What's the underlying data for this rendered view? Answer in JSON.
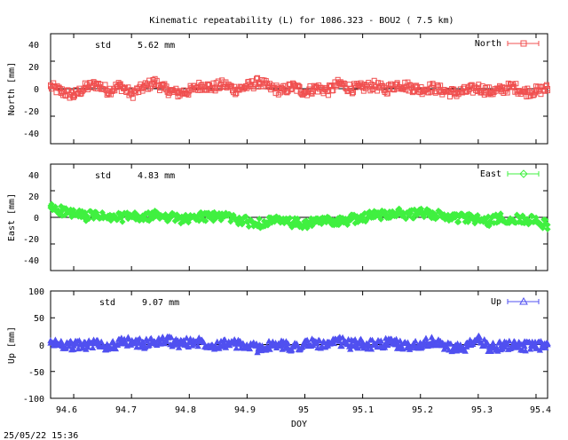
{
  "chart_data": {
    "type": "scatter",
    "title": "Kinematic repeatability (L) for 1086.323 - BOU2  (  7.5 km)",
    "xlabel": "DOY",
    "xlim": [
      94.56,
      95.42
    ],
    "x_ticks": [
      "94.6",
      "94.7",
      "94.8",
      "94.9",
      "95",
      "95.1",
      "95.2",
      "95.3",
      "95.4"
    ],
    "timestamp": "25/05/22 15:36",
    "panels": [
      {
        "ylabel": "North [mm]",
        "ylim": [
          -50,
          50
        ],
        "y_ticks": [
          "40",
          "20",
          "0",
          "-20",
          "-40"
        ],
        "std_label": "std",
        "std_value": "5.62 mm",
        "series": [
          {
            "name": "North",
            "color": "#f05050",
            "marker": "square",
            "x": [
              94.56,
              94.58,
              94.6,
              94.62,
              94.64,
              94.66,
              94.68,
              94.7,
              94.72,
              94.74,
              94.76,
              94.78,
              94.8,
              94.82,
              94.84,
              94.86,
              94.88,
              94.9,
              94.92,
              94.94,
              94.96,
              94.98,
              95.0,
              95.02,
              95.04,
              95.06,
              95.08,
              95.1,
              95.12,
              95.14,
              95.16,
              95.18,
              95.2,
              95.22,
              95.24,
              95.26,
              95.28,
              95.3,
              95.32,
              95.34,
              95.36,
              95.38,
              95.4,
              95.42
            ],
            "y": [
              2,
              -3,
              -6,
              1,
              4,
              -2,
              3,
              -5,
              1,
              6,
              -1,
              -4,
              -2,
              3,
              1,
              4,
              -1,
              2,
              6,
              1,
              -2,
              2,
              -3,
              1,
              -2,
              5,
              0,
              1,
              3,
              -1,
              4,
              2,
              -1,
              1,
              -2,
              -4,
              -2,
              1,
              -3,
              -1,
              2,
              -3,
              -2,
              0
            ]
          }
        ]
      },
      {
        "ylabel": "East [mm]",
        "ylim": [
          -50,
          50
        ],
        "y_ticks": [
          "40",
          "20",
          "0",
          "-20",
          "-40"
        ],
        "std_label": "std",
        "std_value": "4.83 mm",
        "series": [
          {
            "name": "East",
            "color": "#40f040",
            "marker": "diamond",
            "x": [
              94.56,
              94.58,
              94.6,
              94.62,
              94.64,
              94.66,
              94.68,
              94.7,
              94.72,
              94.74,
              94.76,
              94.78,
              94.8,
              94.82,
              94.84,
              94.86,
              94.88,
              94.9,
              94.92,
              94.94,
              94.96,
              94.98,
              95.0,
              95.02,
              95.04,
              95.06,
              95.08,
              95.1,
              95.12,
              95.14,
              95.16,
              95.18,
              95.2,
              95.22,
              95.24,
              95.26,
              95.28,
              95.3,
              95.32,
              95.34,
              95.36,
              95.38,
              95.4,
              95.42
            ],
            "y": [
              9,
              6,
              3,
              1,
              2,
              -1,
              0,
              1,
              -1,
              2,
              1,
              -1,
              -2,
              1,
              0,
              2,
              -2,
              -4,
              -6,
              -3,
              -4,
              -5,
              -7,
              -4,
              -3,
              -4,
              -2,
              0,
              2,
              3,
              5,
              2,
              4,
              3,
              1,
              0,
              -1,
              -2,
              -4,
              0,
              -2,
              -1,
              -4,
              -7
            ]
          }
        ]
      },
      {
        "ylabel": "Up [mm]",
        "ylim": [
          -100,
          100
        ],
        "y_ticks": [
          "100",
          "50",
          "0",
          "-50",
          "-100"
        ],
        "std_label": "std",
        "std_value": "9.07 mm",
        "series": [
          {
            "name": "Up",
            "color": "#5050f0",
            "marker": "triangle",
            "x": [
              94.56,
              94.58,
              94.6,
              94.62,
              94.64,
              94.66,
              94.68,
              94.7,
              94.72,
              94.74,
              94.76,
              94.78,
              94.8,
              94.82,
              94.84,
              94.86,
              94.88,
              94.9,
              94.92,
              94.94,
              94.96,
              94.98,
              95.0,
              95.02,
              95.04,
              95.06,
              95.08,
              95.1,
              95.12,
              95.14,
              95.16,
              95.18,
              95.2,
              95.22,
              95.24,
              95.26,
              95.28,
              95.3,
              95.32,
              95.34,
              95.36,
              95.38,
              95.4,
              95.42
            ],
            "y": [
              3,
              1,
              -2,
              0,
              2,
              -4,
              3,
              6,
              1,
              5,
              9,
              2,
              4,
              6,
              -1,
              3,
              1,
              -3,
              -6,
              -2,
              -1,
              -4,
              1,
              3,
              -2,
              6,
              0,
              2,
              -1,
              3,
              1,
              -3,
              2,
              5,
              -1,
              -8,
              -4,
              10,
              -6,
              -2,
              1,
              -3,
              -4,
              0
            ]
          }
        ]
      }
    ]
  }
}
